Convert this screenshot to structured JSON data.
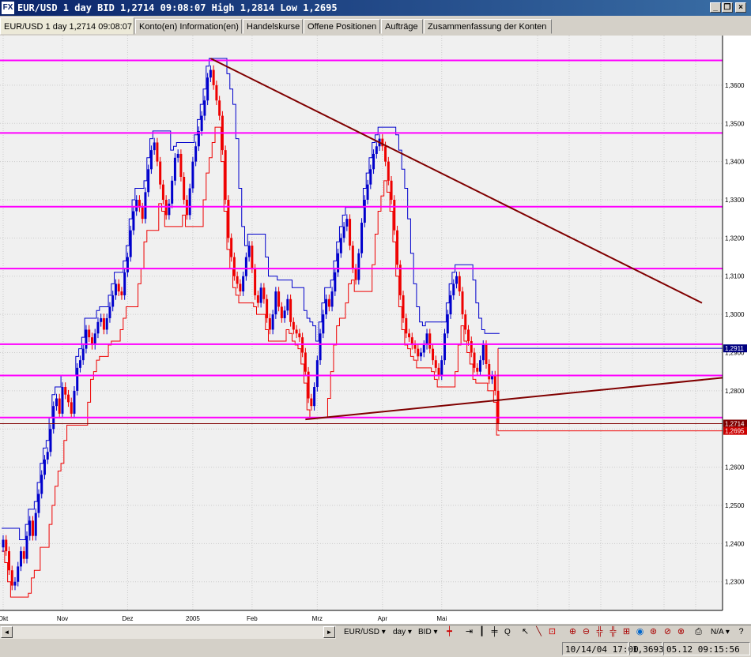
{
  "window": {
    "app_icon": "FX",
    "title": "EUR/USD 1 day BID 1,2714 09:08:07 High 1,2814 Low 1,2695"
  },
  "tabs": [
    {
      "label": "EUR/USD 1 day 1,2714 09:08:07",
      "active": true
    },
    {
      "label": "Konto(en) Information(en)"
    },
    {
      "label": "Handelskurse"
    },
    {
      "label": "Offene Positionen"
    },
    {
      "label": "Aufträge"
    },
    {
      "label": "Zusammenfassung der Konten"
    }
  ],
  "chart_data": {
    "type": "candlestick",
    "y_ticks": [
      "1,2300",
      "1,2400",
      "1,2500",
      "1,2600",
      "1,2700",
      "1,2800",
      "1,2900",
      "1,3000",
      "1,3100",
      "1,3200",
      "1,3300",
      "1,3400",
      "1,3500",
      "1,3600"
    ],
    "y_tick_values": [
      1.23,
      1.24,
      1.25,
      1.26,
      1.27,
      1.28,
      1.29,
      1.3,
      1.31,
      1.32,
      1.33,
      1.34,
      1.35,
      1.36
    ],
    "ylim": [
      1.2225,
      1.373
    ],
    "x_ticks": [
      "Okt",
      "Nov",
      "Dez",
      "2005",
      "Feb",
      "Mrz",
      "Apr",
      "Mai"
    ],
    "horizontal_levels": [
      1.3665,
      1.3475,
      1.3282,
      1.312,
      1.2922,
      1.284,
      1.273
    ],
    "trendlines": [
      {
        "from": [
          1.367
        ],
        "to": [
          1.303
        ],
        "color": "#800000"
      },
      {
        "from": [
          1.2725
        ],
        "to": [
          1.2834
        ],
        "color": "#800000"
      }
    ],
    "price_labels": [
      {
        "text": "1,2911",
        "value": 1.2911,
        "kind": "ask"
      },
      {
        "text": "1,2714",
        "value": 1.2714,
        "kind": "bid"
      },
      {
        "text": "1,2695",
        "value": 1.2695,
        "kind": "low"
      }
    ],
    "last": 1.2714,
    "high": 1.2814,
    "low": 1.2695,
    "close_series": [
      1.241,
      1.238,
      1.233,
      1.229,
      1.23,
      1.234,
      1.238,
      1.236,
      1.242,
      1.246,
      1.242,
      1.248,
      1.253,
      1.258,
      1.262,
      1.264,
      1.27,
      1.276,
      1.278,
      1.274,
      1.281,
      1.279,
      1.277,
      1.274,
      1.28,
      1.286,
      1.288,
      1.291,
      1.296,
      1.294,
      1.292,
      1.295,
      1.298,
      1.299,
      1.296,
      1.299,
      1.302,
      1.305,
      1.308,
      1.306,
      1.305,
      1.311,
      1.315,
      1.322,
      1.327,
      1.33,
      1.328,
      1.325,
      1.332,
      1.338,
      1.343,
      1.345,
      1.34,
      1.334,
      1.33,
      1.326,
      1.329,
      1.335,
      1.341,
      1.342,
      1.336,
      1.33,
      1.326,
      1.333,
      1.34,
      1.344,
      1.348,
      1.352,
      1.356,
      1.362,
      1.364,
      1.36,
      1.356,
      1.352,
      1.343,
      1.33,
      1.32,
      1.315,
      1.31,
      1.308,
      1.306,
      1.31,
      1.315,
      1.318,
      1.312,
      1.305,
      1.303,
      1.307,
      1.304,
      1.299,
      1.296,
      1.3,
      1.306,
      1.302,
      1.299,
      1.301,
      1.304,
      1.298,
      1.296,
      1.295,
      1.294,
      1.29,
      1.285,
      1.278,
      1.276,
      1.281,
      1.288,
      1.295,
      1.3,
      1.304,
      1.302,
      1.306,
      1.311,
      1.316,
      1.32,
      1.323,
      1.325,
      1.318,
      1.312,
      1.309,
      1.316,
      1.324,
      1.33,
      1.334,
      1.338,
      1.342,
      1.344,
      1.346,
      1.344,
      1.34,
      1.335,
      1.33,
      1.322,
      1.313,
      1.305,
      1.299,
      1.295,
      1.294,
      1.292,
      1.291,
      1.289,
      1.29,
      1.292,
      1.295,
      1.291,
      1.288,
      1.286,
      1.284,
      1.288,
      1.295,
      1.3,
      1.305,
      1.308,
      1.31,
      1.306,
      1.3,
      1.296,
      1.293,
      1.29,
      1.286,
      1.285,
      1.288,
      1.292,
      1.287,
      1.283,
      1.284,
      1.28,
      1.2714
    ]
  },
  "scroll": {
    "left_arrow": "◄",
    "right_arrow": "►"
  },
  "toolbar": {
    "instrument": "EUR/USD",
    "period": "day",
    "price": "BID",
    "q_label": "Q",
    "na_label": "N/A"
  },
  "status": {
    "cell1": "10/14/04 17:00",
    "cell2": "1,3693",
    "cell3": "05.12 09:15:56"
  },
  "colors": {
    "bull": "#0000cc",
    "bear": "#ee0000",
    "level": "#ff00ff",
    "trend": "#800000",
    "grid": "#cccccc"
  }
}
